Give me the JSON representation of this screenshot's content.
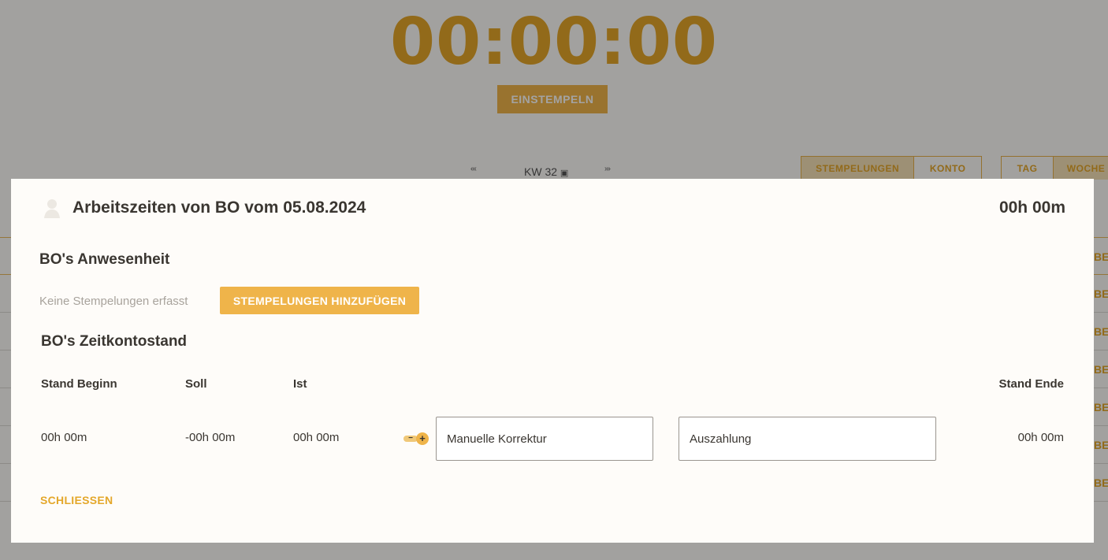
{
  "background": {
    "timer": "00:00:00",
    "clock_in_label": "EINSTEMPELN",
    "week_nav": {
      "prev_icon": "«‹",
      "week_label": "KW 32",
      "calendar_icon": "▣",
      "next_icon": "›»"
    },
    "view_tabs": [
      "STEMPELUNGEN",
      "KONTO"
    ],
    "range_tabs": [
      "TAG",
      "WOCHE"
    ],
    "row_tail": "BE"
  },
  "modal": {
    "title": "Arbeitszeiten von BO vom 05.08.2024",
    "total": "00h 00m",
    "attendance": {
      "title": "BO's Anwesenheit",
      "empty_note": "Keine Stempelungen erfasst",
      "add_label": "STEMPELUNGEN HINZUFÜGEN"
    },
    "account": {
      "title": "BO's Zeitkontostand",
      "headers": {
        "start": "Stand Beginn",
        "target": "Soll",
        "actual": "Ist",
        "end": "Stand Ende"
      },
      "values": {
        "start": "00h 00m",
        "target": "-00h 00m",
        "actual": "00h 00m",
        "end": "00h 00m"
      },
      "minus_icon": "−",
      "plus_icon": "+",
      "correction_placeholder": "Manuelle Korrektur",
      "payout_placeholder": "Auszahlung"
    },
    "close_label": "SCHLIESSEN"
  },
  "colors": {
    "accent": "#efb44a",
    "accent_text": "#e4a72a",
    "text": "#3a3631",
    "muted": "#a8a39c"
  }
}
